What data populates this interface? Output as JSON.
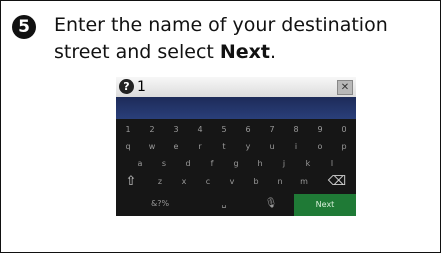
{
  "step": {
    "number": "5",
    "text_before": "Enter the name of your destination street and select ",
    "text_bold": "Next",
    "text_after": "."
  },
  "screen": {
    "input_value": "1",
    "help_label": "?",
    "clear_label": "✕",
    "keyboard": {
      "row1": [
        "1",
        "2",
        "3",
        "4",
        "5",
        "6",
        "7",
        "8",
        "9",
        "0"
      ],
      "row2": [
        "q",
        "w",
        "e",
        "r",
        "t",
        "y",
        "u",
        "i",
        "o",
        "p"
      ],
      "row3": [
        "a",
        "s",
        "d",
        "f",
        "g",
        "h",
        "j",
        "k",
        "l"
      ],
      "row4_letters": [
        "z",
        "x",
        "c",
        "v",
        "b",
        "n",
        "m"
      ],
      "shift_icon": "⇧",
      "backspace_icon": "⌫",
      "symbols_label": "&?%",
      "space_icon": "␣",
      "voice_icon": "🎙",
      "next_label": "Next"
    },
    "colors": {
      "next_button": "#1f7a36",
      "results_area": "#1d2b59",
      "keyboard_bg": "#161616"
    }
  }
}
